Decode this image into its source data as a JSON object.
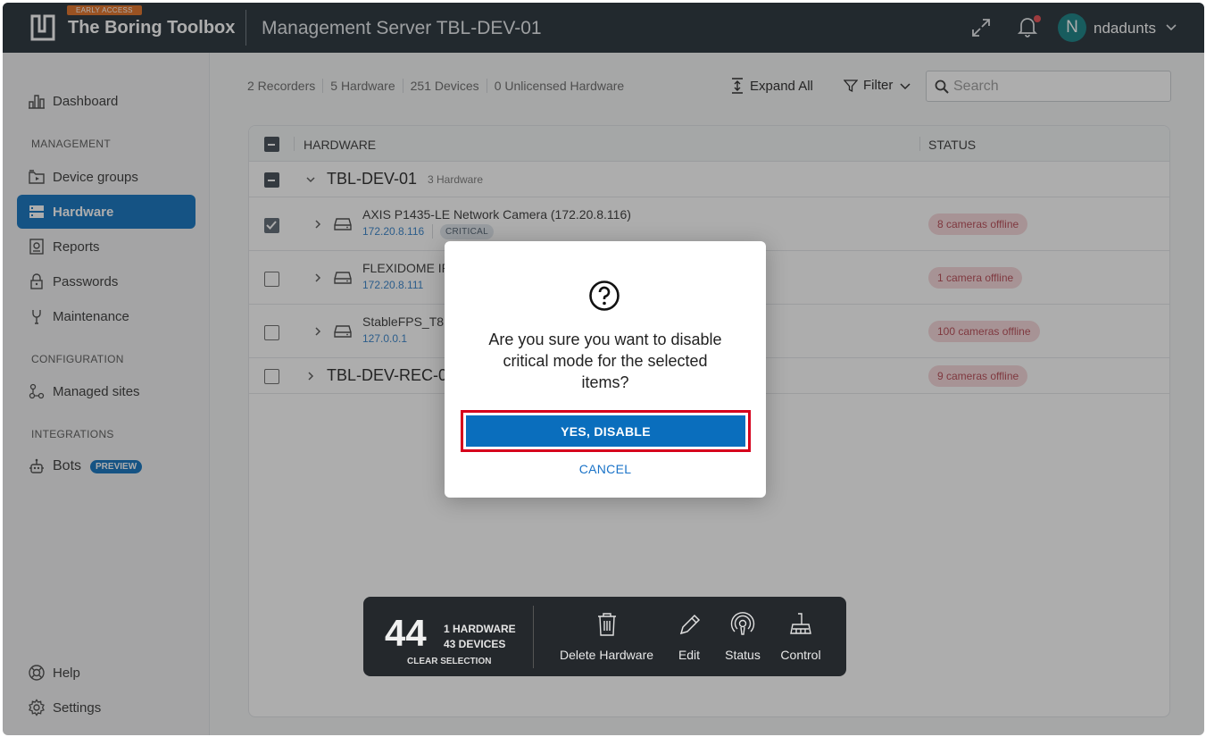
{
  "app": {
    "early_access_label": "EARLY ACCESS",
    "name": "The Boring Toolbox",
    "server_title": "Management Server TBL-DEV-01",
    "username": "ndadunts",
    "avatar_initial": "N"
  },
  "sidebar": {
    "dashboard": "Dashboard",
    "section_management": "MANAGEMENT",
    "device_groups": "Device groups",
    "hardware": "Hardware",
    "reports": "Reports",
    "passwords": "Passwords",
    "maintenance": "Maintenance",
    "section_configuration": "CONFIGURATION",
    "managed_sites": "Managed sites",
    "section_integrations": "INTEGRATIONS",
    "bots": "Bots",
    "bots_badge": "PREVIEW",
    "help": "Help",
    "settings": "Settings"
  },
  "summary": {
    "recorders": "2 Recorders",
    "hardware": "5 Hardware",
    "devices": "251 Devices",
    "unlicensed": "0 Unlicensed Hardware"
  },
  "toolbar": {
    "expand_all": "Expand All",
    "filter": "Filter",
    "search_placeholder": "Search"
  },
  "table": {
    "col_hardware": "HARDWARE",
    "col_status": "STATUS",
    "groups": [
      {
        "name": "TBL-DEV-01",
        "count": "3 Hardware"
      },
      {
        "name": "TBL-DEV-REC-0",
        "status": "9 cameras offline"
      }
    ],
    "rows": [
      {
        "name": "AXIS P1435-LE Network Camera (172.20.8.116)",
        "ip": "172.20.8.116",
        "badge": "CRITICAL",
        "status": "8 cameras offline",
        "checked": true
      },
      {
        "name": "FLEXIDOME IP",
        "ip": "172.20.8.111",
        "status": "1 camera offline",
        "checked": false
      },
      {
        "name": "StableFPS_T8",
        "ip": "127.0.0.1",
        "status": "100 cameras offline",
        "checked": false
      }
    ]
  },
  "action_bar": {
    "count": "44",
    "hardware": "1 HARDWARE",
    "devices": "43 DEVICES",
    "clear": "CLEAR SELECTION",
    "delete": "Delete Hardware",
    "edit": "Edit",
    "status": "Status",
    "control": "Control"
  },
  "modal": {
    "message": "Are you sure you want to disable critical mode for the selected items?",
    "confirm": "YES, DISABLE",
    "cancel": "CANCEL"
  },
  "colors": {
    "topbar": "#1f2a33",
    "accent": "#0a6ebd",
    "status_bg": "#f6d6d9",
    "status_text": "#b5434e",
    "focus_ring": "#d6001c"
  }
}
